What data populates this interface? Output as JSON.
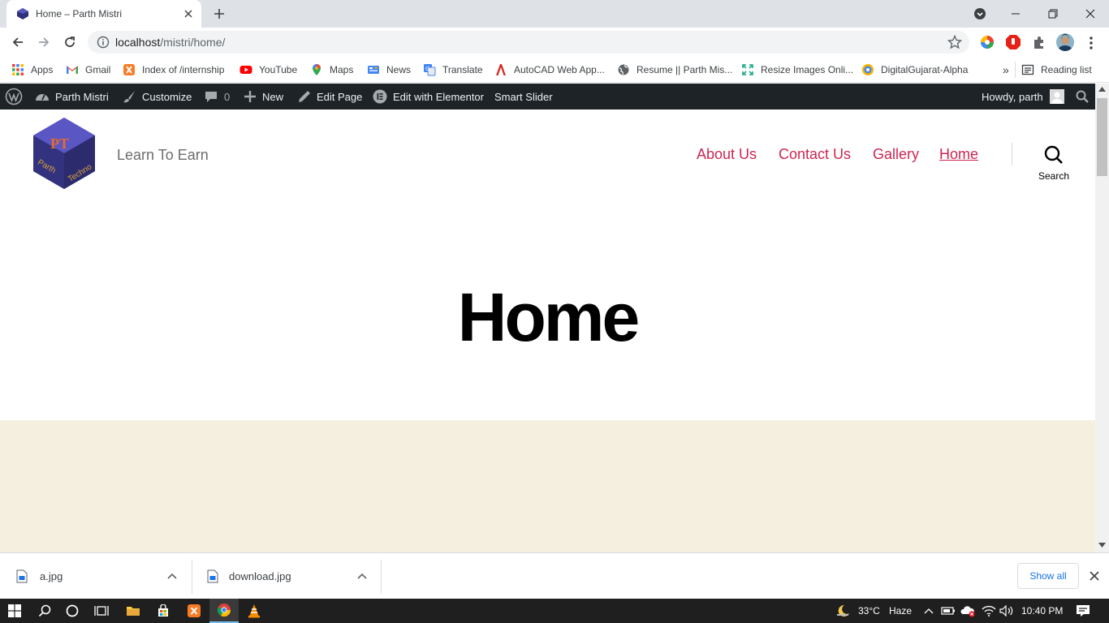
{
  "browser": {
    "tab_title": "Home – Parth Mistri",
    "url_host": "localhost",
    "url_path": "/mistri/home/",
    "bookmarks": [
      {
        "label": "Apps",
        "icon": "apps-grid-icon"
      },
      {
        "label": "Gmail",
        "icon": "gmail-icon"
      },
      {
        "label": "Index of /internship",
        "icon": "xampp-icon"
      },
      {
        "label": "YouTube",
        "icon": "youtube-icon"
      },
      {
        "label": "Maps",
        "icon": "maps-pin-icon"
      },
      {
        "label": "News",
        "icon": "news-icon"
      },
      {
        "label": "Translate",
        "icon": "translate-icon"
      },
      {
        "label": "AutoCAD Web App...",
        "icon": "autocad-icon"
      },
      {
        "label": "Resume || Parth Mis...",
        "icon": "globe-icon"
      },
      {
        "label": "Resize Images Onli...",
        "icon": "resize-icon"
      },
      {
        "label": "DigitalGujarat-Alpha",
        "icon": "digitalgujarat-icon"
      }
    ],
    "more_bookmarks": "»",
    "reading_list": "Reading list"
  },
  "admin_bar": {
    "site_name": "Parth Mistri",
    "customize": "Customize",
    "comments_count": "0",
    "new": "New",
    "edit_page": "Edit Page",
    "elementor": "Edit with Elementor",
    "smart_slider": "Smart Slider",
    "howdy": "Howdy, parth"
  },
  "site": {
    "logo_text_top": "PT",
    "logo_text_left": "Parth",
    "logo_text_right": "Techno",
    "tagline": "Learn To Earn",
    "nav": [
      "About Us",
      "Contact Us",
      "Gallery",
      "Home"
    ],
    "search_label": "Search",
    "page_title": "Home"
  },
  "downloads": {
    "items": [
      "a.jpg",
      "download.jpg"
    ],
    "show_all": "Show all"
  },
  "taskbar": {
    "temperature": "33°C",
    "weather": "Haze",
    "time": "10:40 PM"
  },
  "colors": {
    "nav_accent": "#cd2653",
    "admin_bar_bg": "#1d2327",
    "content_bg": "#f5efe0"
  }
}
